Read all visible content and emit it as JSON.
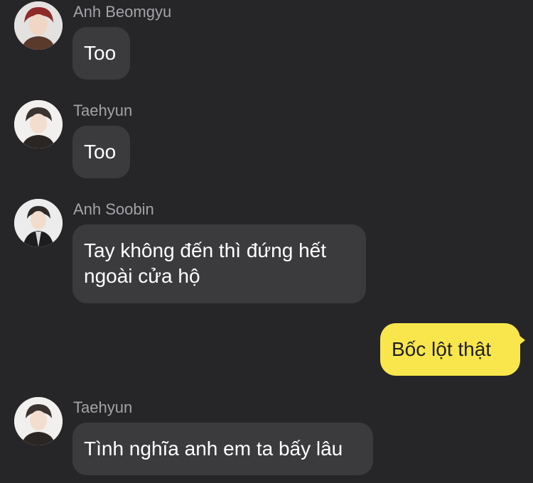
{
  "messages": [
    {
      "sender": "Anh Beomgyu",
      "avatar": "avatar-beomgyu",
      "text": [
        "Too"
      ]
    },
    {
      "sender": "Taehyun",
      "avatar": "avatar-taehyun",
      "text": [
        "Too"
      ]
    },
    {
      "sender": "Anh Soobin",
      "avatar": "avatar-soobin",
      "text": [
        "Tay không đến thì đứng hết",
        "ngoài cửa hộ"
      ]
    },
    {
      "sender": "",
      "mine": true,
      "text": [
        "Bốc lột thật"
      ]
    },
    {
      "sender": "Taehyun",
      "avatar": "avatar-taehyun",
      "text": [
        "Tình nghĩa anh em ta bấy lâu"
      ]
    }
  ],
  "colors": {
    "background": "#262628",
    "incoming_bubble": "#3b3b3e",
    "outgoing_bubble": "#f9e64d",
    "sender_name": "#a3a3a8"
  }
}
